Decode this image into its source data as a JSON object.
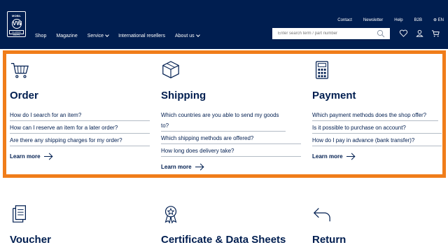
{
  "header": {
    "logo": {
      "top": "MOBIL",
      "mark": "VW",
      "bottom": "CLASSIC PARTS"
    },
    "nav": [
      {
        "label": "Shop",
        "dropdown": false
      },
      {
        "label": "Magazine",
        "dropdown": false
      },
      {
        "label": "Service",
        "dropdown": true
      },
      {
        "label": "International resellers",
        "dropdown": false
      },
      {
        "label": "About us",
        "dropdown": true
      }
    ],
    "top_links": [
      "Contact",
      "Newsletter",
      "Help",
      "B2B",
      "EN"
    ],
    "search": {
      "placeholder": "Enter search term / part number"
    },
    "icons": [
      "heart-icon",
      "user-icon",
      "cart-icon"
    ]
  },
  "highlight_color": "#f07d1a",
  "brand_color": "#001e50",
  "sections": [
    {
      "icon": "cart-icon",
      "title": "Order",
      "links": [
        "How do I search for an item?",
        "How can I reserve an item for a later order?",
        "Are there any shipping charges for my order?"
      ],
      "learn_more": "Learn more"
    },
    {
      "icon": "box-icon",
      "title": "Shipping",
      "links": [
        "Which countries are you able to send my goods to?",
        "Which shipping methods are offered?",
        "How long does delivery take?"
      ],
      "learn_more": "Learn more"
    },
    {
      "icon": "calculator-icon",
      "title": "Payment",
      "links": [
        "Which payment methods does the shop offer?",
        "Is it possible to purchase on account?",
        "How do I pay in advance (bank transfer)?"
      ],
      "learn_more": "Learn more"
    }
  ],
  "lower_sections": [
    {
      "icon": "document-icon",
      "title": "Voucher"
    },
    {
      "icon": "certificate-icon",
      "title": "Certificate & Data Sheets"
    },
    {
      "icon": "return-icon",
      "title": "Return"
    }
  ]
}
